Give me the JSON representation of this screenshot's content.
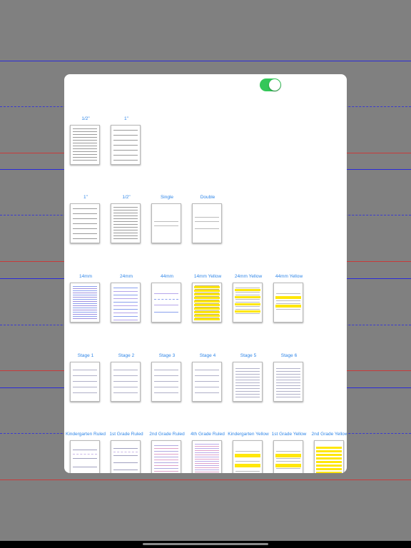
{
  "settings_toggle": {
    "on": true,
    "color": "#34c759"
  },
  "accent_colors": {
    "label": "#2f86e8",
    "yellow": "#ffe70a",
    "background_blue": "#2a2ad8",
    "background_red": "#c83a3a"
  },
  "rows": [
    {
      "items": [
        {
          "label": "1/2\"",
          "style": "dense-gray"
        },
        {
          "label": "1\"",
          "style": "wide-gray"
        }
      ]
    },
    {
      "items": [
        {
          "label": "1\"",
          "style": "wide-gray"
        },
        {
          "label": "1/2\"",
          "style": "dense-gray"
        },
        {
          "label": "Single",
          "style": "single"
        },
        {
          "label": "Double",
          "style": "double"
        }
      ]
    },
    {
      "items": [
        {
          "label": "14mm",
          "style": "blue-purple-dense"
        },
        {
          "label": "24mm",
          "style": "blue-purple-mid"
        },
        {
          "label": "44mm",
          "style": "blue-purple-wide"
        },
        {
          "label": "14mm Yellow",
          "style": "yellow-dense"
        },
        {
          "label": "24mm Yellow",
          "style": "yellow-mid"
        },
        {
          "label": "44mm Yellow",
          "style": "yellow-wide"
        }
      ]
    },
    {
      "items": [
        {
          "label": "Stage 1",
          "style": "stage-wide"
        },
        {
          "label": "Stage 2",
          "style": "stage-wide"
        },
        {
          "label": "Stage 3",
          "style": "stage-wide"
        },
        {
          "label": "Stage 4",
          "style": "stage-wide"
        },
        {
          "label": "Stage 5",
          "style": "stage-dense"
        },
        {
          "label": "Stage 6",
          "style": "stage-dense"
        }
      ]
    },
    {
      "items": [
        {
          "label": "Kindergarten Ruled",
          "style": "ruled-k"
        },
        {
          "label": "1st Grade Ruled",
          "style": "ruled-1"
        },
        {
          "label": "2nd Grade Ruled",
          "style": "ruled-2"
        },
        {
          "label": "4th Grade Ruled",
          "style": "ruled-4"
        },
        {
          "label": "Kindergarten Yellow",
          "style": "yellow-k"
        },
        {
          "label": "1st Grade Yellow",
          "style": "yellow-1"
        },
        {
          "label": "2nd Grade Yellow",
          "style": "yellow-2"
        }
      ]
    }
  ]
}
